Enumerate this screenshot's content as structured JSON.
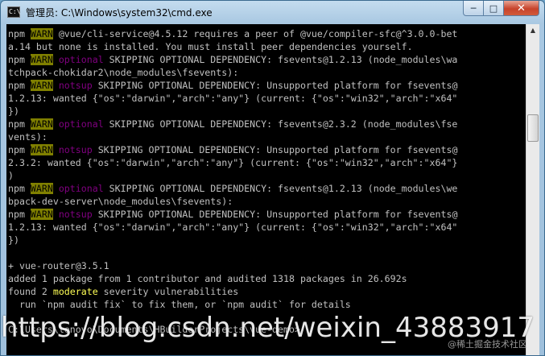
{
  "window": {
    "title": "管理员: C:\\Windows\\system32\\cmd.exe",
    "icon_label": "C:\\",
    "controls": {
      "minimize": "─",
      "maximize": "□",
      "close": "✕"
    }
  },
  "console": {
    "lines": [
      [
        {
          "t": "npm "
        },
        {
          "t": "WARN",
          "c": "warn"
        },
        {
          "t": " @vue/cli-service@4.5.12 requires a peer of @vue/compiler-sfc@^3.0.0-bet"
        }
      ],
      [
        {
          "t": "a.14 but none is installed. You must install peer dependencies yourself."
        }
      ],
      [
        {
          "t": "npm "
        },
        {
          "t": "WARN",
          "c": "warn"
        },
        {
          "t": " "
        },
        {
          "t": "optional",
          "c": "optional"
        },
        {
          "t": " SKIPPING OPTIONAL DEPENDENCY: fsevents@1.2.13 (node_modules\\wa"
        }
      ],
      [
        {
          "t": "tchpack-chokidar2\\node_modules\\fsevents):"
        }
      ],
      [
        {
          "t": "npm "
        },
        {
          "t": "WARN",
          "c": "warn"
        },
        {
          "t": " "
        },
        {
          "t": "notsup",
          "c": "notsup"
        },
        {
          "t": " SKIPPING OPTIONAL DEPENDENCY: Unsupported platform for fsevents@"
        }
      ],
      [
        {
          "t": "1.2.13: wanted {\"os\":\"darwin\",\"arch\":\"any\"} (current: {\"os\":\"win32\",\"arch\":\"x64\""
        }
      ],
      [
        {
          "t": "})"
        }
      ],
      [
        {
          "t": "npm "
        },
        {
          "t": "WARN",
          "c": "warn"
        },
        {
          "t": " "
        },
        {
          "t": "optional",
          "c": "optional"
        },
        {
          "t": " SKIPPING OPTIONAL DEPENDENCY: fsevents@2.3.2 (node_modules\\fse"
        }
      ],
      [
        {
          "t": "vents):"
        }
      ],
      [
        {
          "t": "npm "
        },
        {
          "t": "WARN",
          "c": "warn"
        },
        {
          "t": " "
        },
        {
          "t": "notsup",
          "c": "notsup"
        },
        {
          "t": " SKIPPING OPTIONAL DEPENDENCY: Unsupported platform for fsevents@"
        }
      ],
      [
        {
          "t": "2.3.2: wanted {\"os\":\"darwin\",\"arch\":\"any\"} (current: {\"os\":\"win32\",\"arch\":\"x64\"}"
        }
      ],
      [
        {
          "t": ")"
        }
      ],
      [
        {
          "t": "npm "
        },
        {
          "t": "WARN",
          "c": "warn"
        },
        {
          "t": " "
        },
        {
          "t": "optional",
          "c": "optional"
        },
        {
          "t": " SKIPPING OPTIONAL DEPENDENCY: fsevents@1.2.13 (node_modules\\we"
        }
      ],
      [
        {
          "t": "bpack-dev-server\\node_modules\\fsevents):"
        }
      ],
      [
        {
          "t": "npm "
        },
        {
          "t": "WARN",
          "c": "warn"
        },
        {
          "t": " "
        },
        {
          "t": "notsup",
          "c": "notsup"
        },
        {
          "t": " SKIPPING OPTIONAL DEPENDENCY: Unsupported platform for fsevents@"
        }
      ],
      [
        {
          "t": "1.2.13: wanted {\"os\":\"darwin\",\"arch\":\"any\"} (current: {\"os\":\"win32\",\"arch\":\"x64\""
        }
      ],
      [
        {
          "t": "})"
        }
      ],
      [
        {
          "t": ""
        }
      ],
      [
        {
          "t": "+ vue-router@3.5.1"
        }
      ],
      [
        {
          "t": "added 1 package from 1 contributor and audited 1318 packages in 26.692s"
        }
      ],
      [
        {
          "t": "found 2 "
        },
        {
          "t": "moderate",
          "c": "moderate"
        },
        {
          "t": " severity vulnerabilities"
        }
      ],
      [
        {
          "t": "  run `npm audit fix` to fix them, or `npm audit` for details"
        }
      ]
    ],
    "partial_prompt": "C:\\Users\\lenovo\\Documents\\HBuilderProjects\\vue-demo>"
  },
  "scrollbar": {
    "up_arrow": "▲"
  },
  "watermark": {
    "main": "https://blog.csdn.net/weixin_43883917",
    "secondary": "@稀土掘金技术社区"
  }
}
